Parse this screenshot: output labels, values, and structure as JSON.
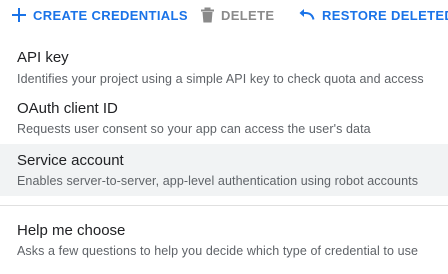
{
  "toolbar": {
    "create_label": "CREATE CREDENTIALS",
    "delete_label": "DELETE",
    "restore_label": "RESTORE DELETED CR"
  },
  "menu": {
    "items": [
      {
        "title": "API key",
        "description": "Identifies your project using a simple API key to check quota and access"
      },
      {
        "title": "OAuth client ID",
        "description": "Requests user consent so your app can access the user's data"
      },
      {
        "title": "Service account",
        "description": "Enables server-to-server, app-level authentication using robot accounts"
      },
      {
        "title": "Help me choose",
        "description": "Asks a few questions to help you decide which type of credential to use"
      }
    ]
  },
  "colors": {
    "accent": "#1a73e8",
    "disabled": "#8a8a8a",
    "hover_bg": "#f1f3f4"
  }
}
